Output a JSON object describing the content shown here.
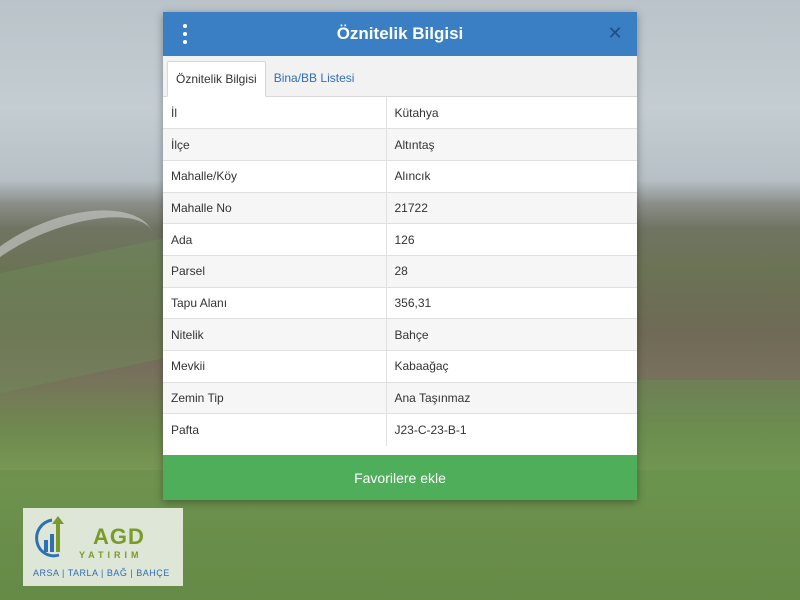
{
  "dialog": {
    "title": "Öznitelik Bilgisi",
    "close_symbol": "✕"
  },
  "tabs": [
    {
      "label": "Öznitelik Bilgisi",
      "active": true
    },
    {
      "label": "Bina/BB Listesi",
      "active": false
    }
  ],
  "attributes": [
    {
      "key": "İl",
      "value": "Kütahya"
    },
    {
      "key": "İlçe",
      "value": "Altıntaş"
    },
    {
      "key": "Mahalle/Köy",
      "value": "Alıncık"
    },
    {
      "key": "Mahalle No",
      "value": "21722"
    },
    {
      "key": "Ada",
      "value": "126"
    },
    {
      "key": "Parsel",
      "value": "28"
    },
    {
      "key": "Tapu Alanı",
      "value": "356,31"
    },
    {
      "key": "Nitelik",
      "value": "Bahçe"
    },
    {
      "key": "Mevkii",
      "value": "Kabaağaç"
    },
    {
      "key": "Zemin Tip",
      "value": "Ana Taşınmaz"
    },
    {
      "key": "Pafta",
      "value": "J23-C-23-B-1"
    }
  ],
  "favorite_button": "Favorilere ekle",
  "logo": {
    "brand": "AGD",
    "subtitle": "YATIRIM",
    "tagline": "ARSA | TARLA | BAĞ | BAHÇE"
  },
  "colors": {
    "header": "#3a7fc4",
    "close": "#1f4d86",
    "tab_link": "#2f6fb3",
    "button": "#4fae5a",
    "logo_green": "#7a9b2a"
  },
  "icons": {
    "menu": "vertical-dots-icon",
    "close": "close-icon",
    "logo": "chart-arrow-logo-icon"
  }
}
